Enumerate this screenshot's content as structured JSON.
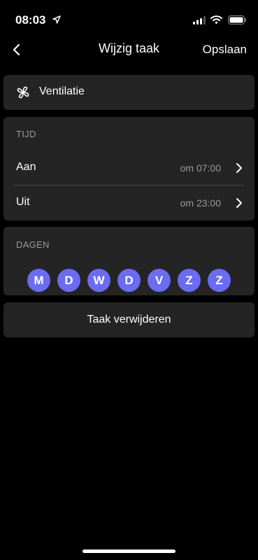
{
  "status_bar": {
    "time": "08:03",
    "location_icon": "location-arrow-icon",
    "signal_icon": "cellular-signal-icon",
    "wifi_icon": "wifi-icon",
    "battery_icon": "battery-icon"
  },
  "nav": {
    "back_icon": "chevron-left-icon",
    "title": "Wijzig taak",
    "save_label": "Opslaan"
  },
  "device": {
    "icon": "fan-icon",
    "label": "Ventilatie"
  },
  "time_section": {
    "label": "TIJD",
    "rows": [
      {
        "label": "Aan",
        "value": "om 07:00",
        "icon": "chevron-right-icon"
      },
      {
        "label": "Uit",
        "value": "om 23:00",
        "icon": "chevron-right-icon"
      }
    ]
  },
  "days_section": {
    "label": "DAGEN",
    "days": [
      "M",
      "D",
      "W",
      "D",
      "V",
      "Z",
      "Z"
    ],
    "selected_color": "#6b6cf2"
  },
  "delete": {
    "label": "Taak verwijderen"
  },
  "colors": {
    "background": "#000000",
    "card": "#242424",
    "secondary_text": "#9a9a9a",
    "accent": "#6b6cf2"
  }
}
